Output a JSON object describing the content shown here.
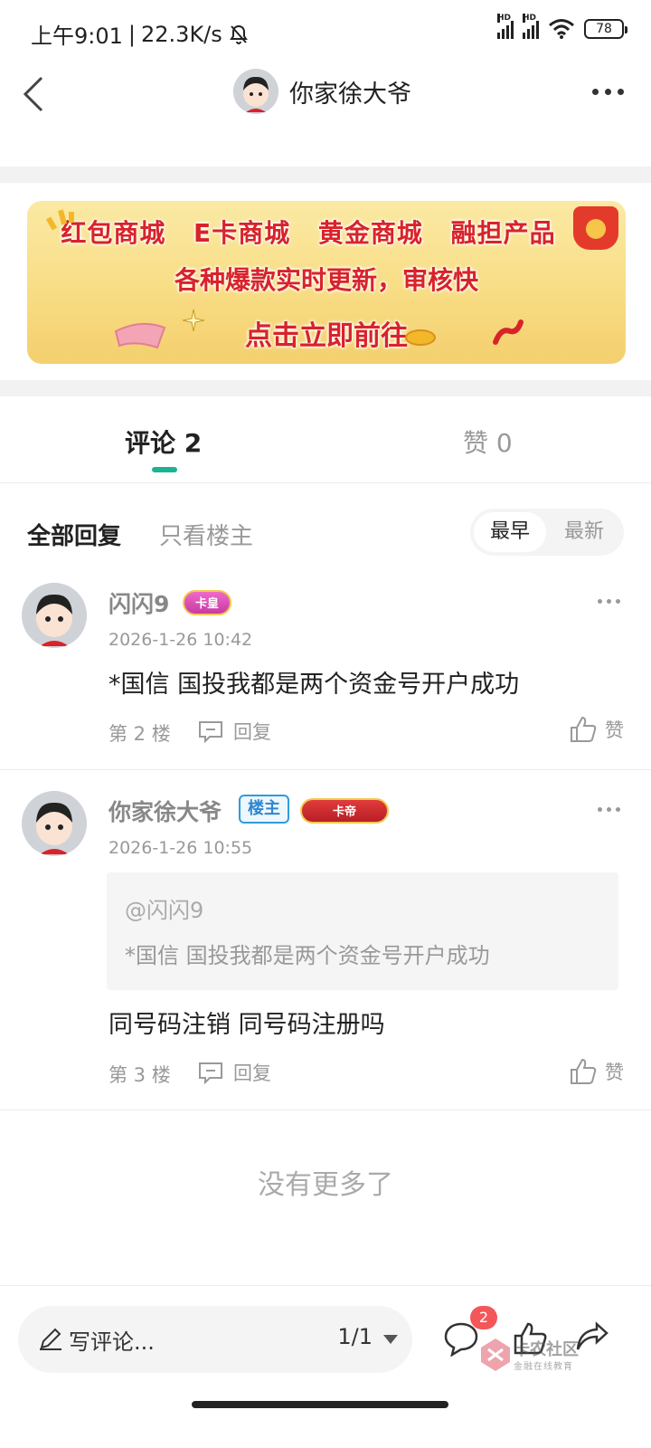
{
  "status_bar": {
    "time": "上午9:01",
    "speed": "22.3K/s",
    "battery": "78",
    "net_label": "HD"
  },
  "nav": {
    "title": "你家徐大爷"
  },
  "banner": {
    "row1": "红包商城 E卡商城 黄金商城 融担产品",
    "row2": "各种爆款实时更新，审核快",
    "row3": "点击立即前往"
  },
  "tabs": {
    "comments": "评论 2",
    "likes": "赞 0"
  },
  "filter": {
    "all": "全部回复",
    "owner_only": "只看楼主",
    "sort_earliest": "最早",
    "sort_latest": "最新"
  },
  "comments": [
    {
      "user": "闪闪9",
      "badge": "卡皇",
      "time": "2026-1-26 10:42",
      "body": "*国信 国投我都是两个资金号开户成功",
      "floor": "第 2 楼",
      "reply": "回复",
      "like": "赞"
    },
    {
      "user": "你家徐大爷",
      "owner_tag": "楼主",
      "badge": "卡帝",
      "time": "2026-1-26 10:55",
      "quote_at": "@闪闪9",
      "quote_text": "*国信 国投我都是两个资金号开户成功",
      "body": "同号码注销 同号码注册吗",
      "floor": "第 3 楼",
      "reply": "回复",
      "like": "赞"
    }
  ],
  "no_more": "没有更多了",
  "bottom_bar": {
    "placeholder": "写评论...",
    "page": "1/1",
    "comment_count": "2",
    "watermark": "卡农社区",
    "watermark_sub": "金融在线教育"
  },
  "colors": {
    "accent": "#1ab394",
    "owner_tag": "#2f86d0",
    "badge_red": "#f4575a"
  }
}
